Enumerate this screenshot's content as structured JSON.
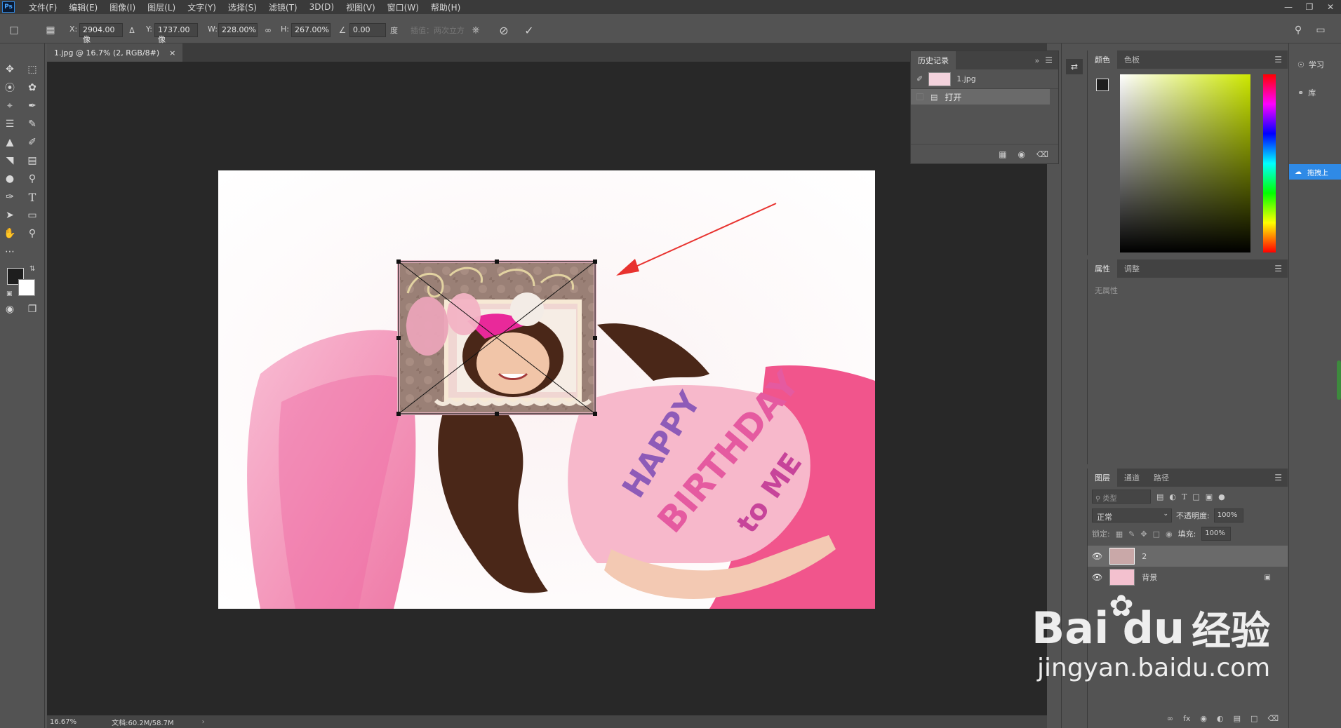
{
  "menubar": {
    "logo": "Ps",
    "items": [
      "文件(F)",
      "编辑(E)",
      "图像(I)",
      "图层(L)",
      "文字(Y)",
      "选择(S)",
      "滤镜(T)",
      "3D(D)",
      "视图(V)",
      "窗口(W)",
      "帮助(H)"
    ]
  },
  "options": {
    "x_label": "X:",
    "x_value": "2904.00 像",
    "y_label": "Y:",
    "y_value": "1737.00 像",
    "w_label": "W:",
    "w_value": "228.00%",
    "h_label": "H:",
    "h_value": "267.00%",
    "angle_value": "0.00",
    "angle_unit": "度",
    "interp_label": "插值：两次立方"
  },
  "document": {
    "tab_title": "1.jpg @ 16.7% (2, RGB/8#)",
    "tab_close": "×",
    "zoom": "16.67%",
    "doc_size": "文档:60.2M/58.7M",
    "tshirt_text_1": "HAPPY",
    "tshirt_text_2": "BIRTHDAY",
    "tshirt_text_3": "to ME"
  },
  "history": {
    "tab_label": "历史记录",
    "snapshot_name": "1.jpg",
    "steps": [
      "打开"
    ]
  },
  "color_panel": {
    "tabs": [
      "颜色",
      "色板"
    ]
  },
  "properties_panel": {
    "tabs": [
      "属性",
      "调整"
    ],
    "empty_text": "无属性"
  },
  "layers_panel": {
    "tabs": [
      "图层",
      "通道",
      "路径"
    ],
    "filter_placeholder": "类型",
    "blend_mode": "正常",
    "opacity_label": "不透明度:",
    "opacity_value": "100%",
    "lock_label": "锁定:",
    "fill_label": "填充:",
    "fill_value": "100%",
    "layers": [
      {
        "name": "2"
      },
      {
        "name": "背景"
      }
    ]
  },
  "right_strip": {
    "learn_label": "学习",
    "library_label": "库",
    "baidu_label": "拖拽上"
  },
  "watermark": {
    "brand": "Bai",
    "brand2": "du",
    "cn": "经验",
    "url": "jingyan.baidu.com"
  },
  "colors": {
    "arrow": "#e8322f",
    "accent_blue": "#2f8ae6",
    "pink": "#f06ba3"
  }
}
